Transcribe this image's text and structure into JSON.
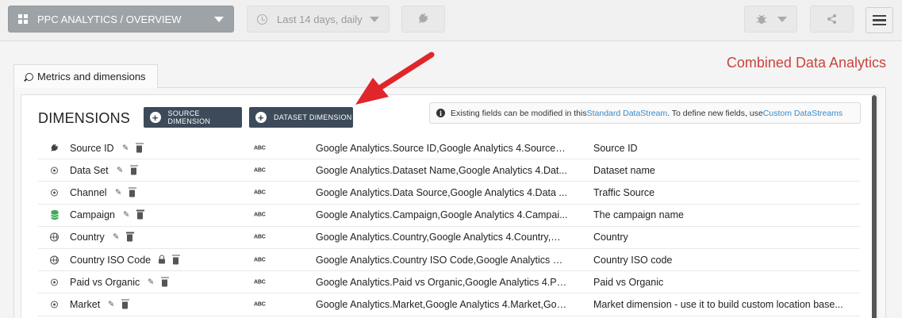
{
  "toolbar": {
    "view_label": "PPC ANALYTICS / OVERVIEW",
    "date_label": "Last 14 days, daily"
  },
  "page": {
    "title": "Combined Data Analytics",
    "tab_label": "Metrics and dimensions"
  },
  "dimensions": {
    "heading": "DIMENSIONS",
    "source_button": "SOURCE DIMENSION",
    "dataset_button": "DATASET DIMENSION",
    "info_text_1": "Existing fields can be modified in this ",
    "info_link_1": "Standard DataStream",
    "info_text_2": ". To define new fields, use ",
    "info_link_2": "Custom DataStreams",
    "rows": [
      {
        "icon": "plug-icon",
        "name": "Source ID",
        "type": "ABC",
        "source": "Google Analytics.Source ID,Google Analytics 4.Source I...",
        "description": "Source ID",
        "locked": false
      },
      {
        "icon": "target-icon",
        "name": "Data Set",
        "type": "ABC",
        "source": "Google Analytics.Dataset Name,Google Analytics 4.Dat...",
        "description": "Dataset name",
        "locked": false
      },
      {
        "icon": "target-icon",
        "name": "Channel",
        "type": "ABC",
        "source": "Google Analytics.Data Source,Google Analytics 4.Data ...",
        "description": "Traffic Source",
        "locked": false
      },
      {
        "icon": "database-icon",
        "name": "Campaign",
        "type": "ABC",
        "source": "Google Analytics.Campaign,Google Analytics 4.Campai...",
        "description": "The campaign name",
        "locked": false
      },
      {
        "icon": "globe-icon",
        "name": "Country",
        "type": "ABC",
        "source": "Google Analytics.Country,Google Analytics 4.Country,Go...",
        "description": "Country",
        "locked": false
      },
      {
        "icon": "globe-icon",
        "name": "Country ISO Code",
        "type": "ABC",
        "source": "Google Analytics.Country ISO Code,Google Analytics 4....",
        "description": "Country ISO code",
        "locked": true
      },
      {
        "icon": "target-icon",
        "name": "Paid vs Organic",
        "type": "ABC",
        "source": "Google Analytics.Paid vs Organic,Google Analytics 4.Pa...",
        "description": "Paid vs Organic",
        "locked": false
      },
      {
        "icon": "target-icon",
        "name": "Market",
        "type": "ABC",
        "source": "Google Analytics.Market,Google Analytics 4.Market,Goo...",
        "description": "Market dimension - use it to build custom location base...",
        "locked": false
      }
    ]
  },
  "colors": {
    "accent_title": "#c9443b",
    "dark_button": "#3d4a5a",
    "link": "#3a8ac8",
    "arrow": "#e0262b"
  }
}
